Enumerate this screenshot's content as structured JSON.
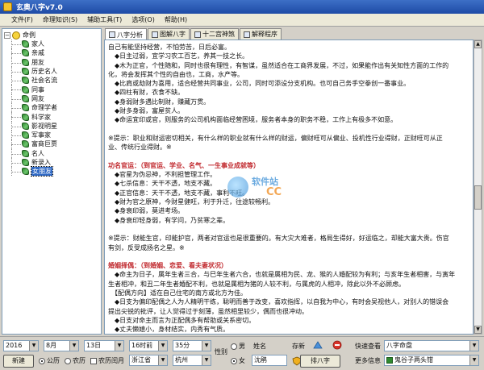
{
  "window": {
    "title": "玄奥八字v7.0"
  },
  "menu": [
    "文件(F)",
    "命理知识(S)",
    "辅助工具(T)",
    "选项(O)",
    "帮助(H)"
  ],
  "tree": {
    "root": "命例",
    "items": [
      "家人",
      "亲戚",
      "朋友",
      "历史名人",
      "社会名流",
      "同事",
      "网友",
      "命理学者",
      "科学家",
      "影视明星",
      "军事家",
      "富商巨贾",
      "名人",
      "新录入",
      "女朋友"
    ],
    "selected_index": 14
  },
  "tabs": [
    "八字分析",
    "图解八字",
    "十二宫神煞",
    "解释程序"
  ],
  "content_lines": [
    {
      "t": "自己有能坚持经营，不怕劳苦，日后必富。",
      "h": false
    },
    {
      "t": "　◆日主过弱，宜学习农工百艺，养其一技之长。",
      "h": false
    },
    {
      "t": "　◆木为正官，个性随和，同时也很有理性，有智谋，虽然适合在工商界发展，不过，如果能作出有关知性方面的工作的",
      "h": false
    },
    {
      "t": "化，将会发挥其个性的自由也，工商，水产等。",
      "h": false
    },
    {
      "t": "　◆比肩或劫财为喜用，适合经营共同事业，公司，同时可添设分支机构。也可自己务手空拳创一番事业。",
      "h": false
    },
    {
      "t": "　◆四柱有财，衣食不缺。",
      "h": false
    },
    {
      "t": "　◆身弱财多遇比制财，赚藏万贯。",
      "h": false
    },
    {
      "t": "　◆财多身弱，富屋贫人。",
      "h": false
    },
    {
      "t": "　◆命运宜印或官，则服务的公司机构面临经营困境，服务者本身的职务不稳，工作上有极多不如意。",
      "h": false
    },
    {
      "t": "",
      "h": false
    },
    {
      "t": "※提示：职业和财运密切相关，有什么样的职业就有什么样的财运，偏财旺可从偏业、投机性行业得财，正财旺可从正",
      "h": false
    },
    {
      "t": "业、传统行业得财。※",
      "h": false
    },
    {
      "t": "",
      "h": false
    },
    {
      "t": "功名官运：（到官运、学业、名气、一生事业成就等）",
      "h": true
    },
    {
      "t": "　◆官星为伪忌神，不利担管理工作。",
      "h": false
    },
    {
      "t": "　◆七杀信息：天干不透，地支不藏。",
      "h": false
    },
    {
      "t": "　◆正官信息：天干不透，地支不藏，事利不旺。",
      "h": false
    },
    {
      "t": "　◆财为官之原神，今财星健旺，利于升迁，往途较畅利。",
      "h": false
    },
    {
      "t": "　◆身衰印弱，莫进考场。",
      "h": false
    },
    {
      "t": "　◆身衰印轻身弱，有学问，乃贫寒之辈。",
      "h": false
    },
    {
      "t": "",
      "h": false
    },
    {
      "t": "※提示：财能生官，印能护官，两者对官运也是很重要的。有大灾大难者，格局生得好，好运临之，却能大富大贵。伤官",
      "h": false
    },
    {
      "t": "有剑，反受成扬名之星。※",
      "h": false
    },
    {
      "t": "",
      "h": false
    },
    {
      "t": "婚姻择偶：（到婚姻、恋爱、看夫妻状况）",
      "h": true
    },
    {
      "t": "　◆命主为日子，属年生者三合，与巳年生者六合，也就是属相为民、龙、猴的人婚配较为有利；与亥年生者相害，与寅年",
      "h": false
    },
    {
      "t": "生者相冲，和丑二年生者婚配不利，也就是属相为猪的人较不利，与属虎的人相冲，除此以外不必顾虑。",
      "h": false
    },
    {
      "t": "　【配偶方向】适在自己住宅的南方或北方为佳。",
      "h": false
    },
    {
      "t": "　◆日支为偏印配偶之人为人精明干练，聪明而善于改变，喜欢指挥，以自我为中心，有时会吴视他人，对别人的错误会",
      "h": false
    },
    {
      "t": "提出尖锐的批评，让人觉得过于刻薄，虽然相里较少，偶而也很冲动。",
      "h": false
    },
    {
      "t": "　◆日支对命主而言为正配偶多有帮助或关系密切。",
      "h": false
    },
    {
      "t": "　◆丈夫懒媳小，身材结实，内秀有气质。",
      "h": false
    },
    {
      "t": "　◆日干专相干，夫妻和睦，相互了解多有助益。",
      "h": false
    }
  ],
  "watermark": {
    "text": "软件站",
    "domain": "CC"
  },
  "bottom": {
    "year": "2016",
    "month": "8月",
    "day": "13日",
    "hour": "16时前",
    "minute": "35分",
    "new_button": "新建",
    "cal_gong": "公历",
    "cal_nong": "农历",
    "leap_month": "农历闰月",
    "province": "浙江省",
    "city": "杭州",
    "gender_label": "性别",
    "male": "男",
    "female": "女",
    "name_label": "姓名",
    "name_value": "沈鹃",
    "save_label": "存新",
    "paipan_button": "排八字",
    "quick_label": "快速查看",
    "quick_value": "八字命盘",
    "more_label": "更多信息",
    "more_value": "鬼谷子两头钳"
  }
}
